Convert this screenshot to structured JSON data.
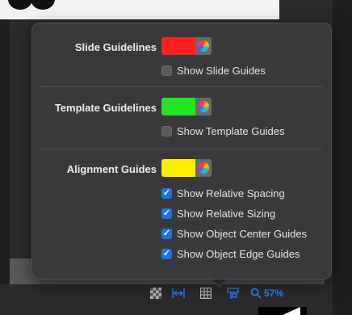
{
  "popover": {
    "slide_guidelines": {
      "label": "Slide Guidelines",
      "color": "#ff1f1f",
      "checkbox_label": "Show Slide Guides",
      "checked": false
    },
    "template_guidelines": {
      "label": "Template Guidelines",
      "color": "#22e622",
      "checkbox_label": "Show Template Guides",
      "checked": false
    },
    "alignment_guides": {
      "label": "Alignment Guides",
      "color": "#ffee00",
      "options": [
        {
          "label": "Show Relative Spacing",
          "checked": true
        },
        {
          "label": "Show Relative Sizing",
          "checked": true
        },
        {
          "label": "Show Object Center Guides",
          "checked": true
        },
        {
          "label": "Show Object Edge Guides",
          "checked": true
        }
      ]
    }
  },
  "toolbar": {
    "icons": [
      "checkerboard-icon",
      "fit-width-icon",
      "grid-icon",
      "guides-icon",
      "zoom-icon"
    ],
    "zoom_label": "57%",
    "accent": "#2f7ff5"
  }
}
